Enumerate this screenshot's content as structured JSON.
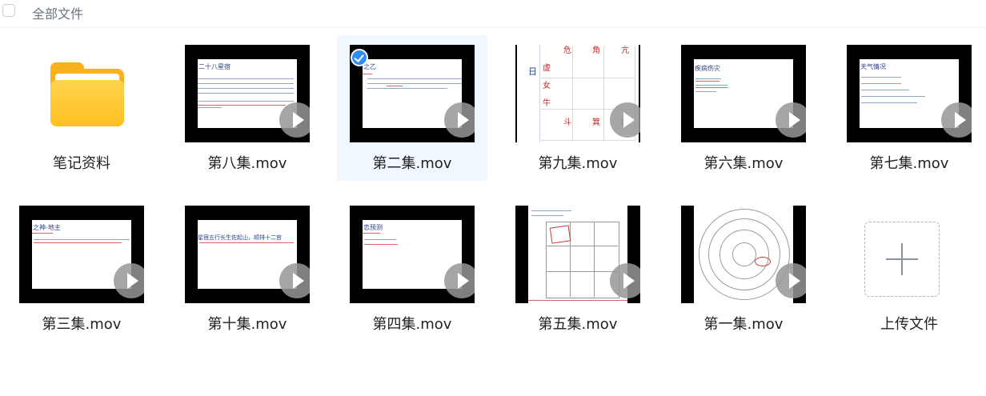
{
  "header": {
    "title": "全部文件"
  },
  "items": [
    {
      "label": "笔记资料",
      "type": "folder"
    },
    {
      "label": "第八集.mov",
      "type": "video",
      "thumb_heading": "二十八星宿"
    },
    {
      "label": "第二集.mov",
      "type": "video",
      "selected": true,
      "thumb_heading": "之乙"
    },
    {
      "label": "第九集.mov",
      "type": "video",
      "thumb_heading": "日",
      "grid_labels": [
        "危",
        "角",
        "亢",
        "虚",
        "女",
        "牛",
        "斗",
        "箕",
        "尾"
      ]
    },
    {
      "label": "第六集.mov",
      "type": "video",
      "thumb_heading": "疾病伤灾"
    },
    {
      "label": "第七集.mov",
      "type": "video",
      "thumb_heading": "天气情况"
    },
    {
      "label": "第三集.mov",
      "type": "video",
      "thumb_heading": "之神-地主"
    },
    {
      "label": "第十集.mov",
      "type": "video",
      "thumb_heading": "星宿五行长生佐起山，顺排十二宫"
    },
    {
      "label": "第四集.mov",
      "type": "video",
      "thumb_heading": "恋预测"
    },
    {
      "label": "第五集.mov",
      "type": "video"
    },
    {
      "label": "第一集.mov",
      "type": "video"
    },
    {
      "label": "上传文件",
      "type": "upload"
    }
  ],
  "colors": {
    "selection_bg": "#f1f7fe",
    "check_badge": "#2f8ef4",
    "folder": "#ffc01e"
  }
}
